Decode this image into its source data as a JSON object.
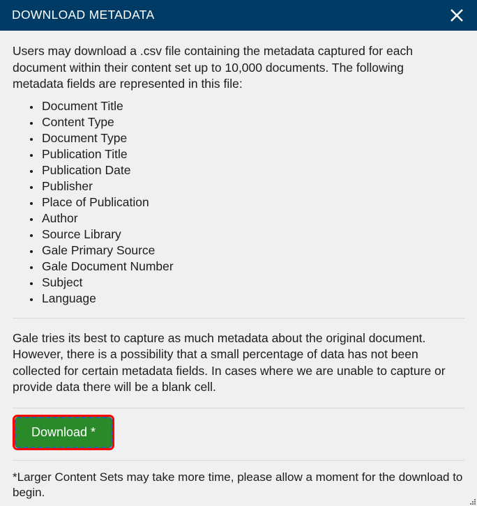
{
  "header": {
    "title": "DOWNLOAD METADATA",
    "close_label": "Close",
    "close_icon": "close-icon",
    "background_color": "#003b66",
    "title_color": "#ffffff"
  },
  "body": {
    "intro_paragraph": "Users may download a .csv file containing the metadata captured for each document within their content set up to 10,000 documents. The following metadata fields are represented in this file:",
    "metadata_fields": [
      "Document Title",
      "Content Type",
      "Document Type",
      "Publication Title",
      "Publication Date",
      "Publisher",
      "Place of Publication",
      "Author",
      "Source Library",
      "Gale Primary Source",
      "Gale Document Number",
      "Subject",
      "Language"
    ],
    "note_paragraph": "Gale tries its best to capture as much metadata about the original document. However, there is a possibility that a small percentage of data has not been collected for certain metadata fields. In cases where we are unable to capture or provide data there will be a blank cell.",
    "footnote": "*Larger Content Sets may take more time, please allow a moment for the download to begin."
  },
  "actions": {
    "download_label": "Download *",
    "download_background_color": "#2a8a2a",
    "download_text_color": "#ffffff",
    "focus_outline_color": "#ff0000",
    "focus_dash_color": "#2f5fa8"
  },
  "colors": {
    "page_background": "#f0f0f0",
    "text": "#1c1c1c",
    "divider": "#d8d8d8"
  }
}
